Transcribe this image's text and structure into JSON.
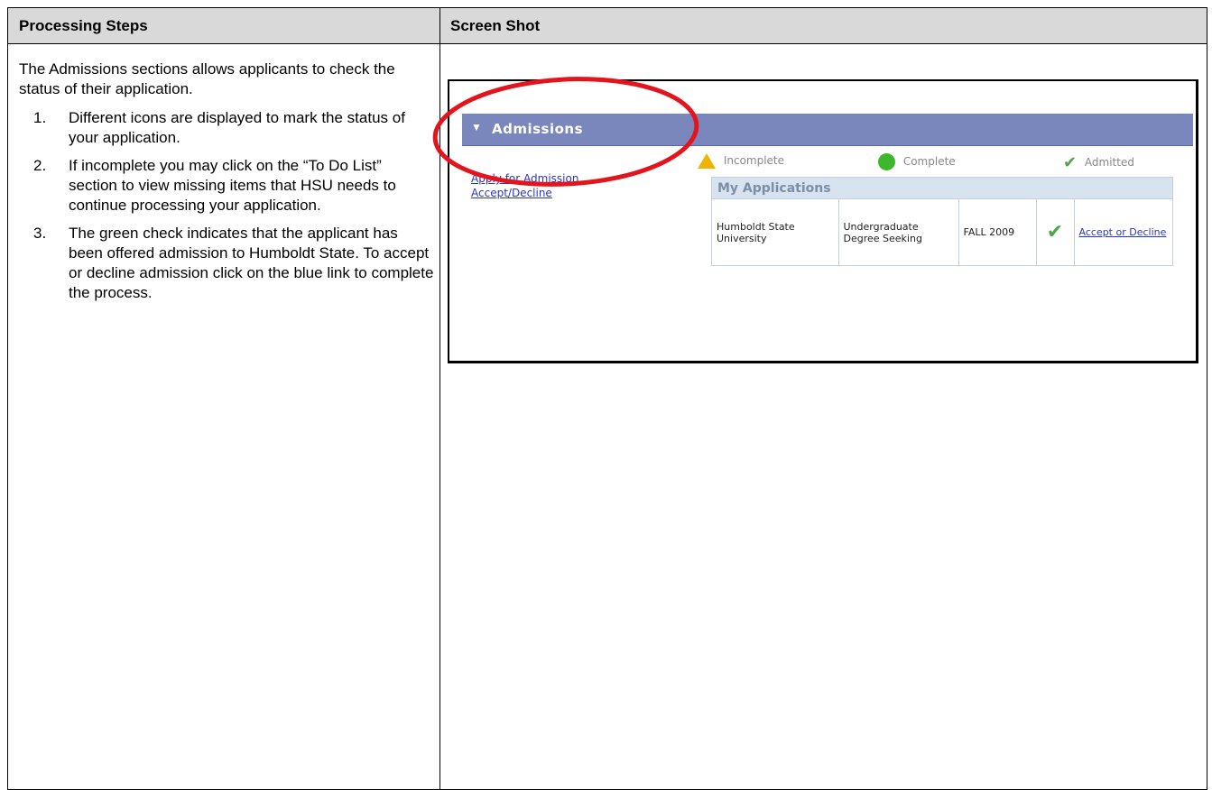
{
  "header": {
    "left": "Processing Steps",
    "right": "Screen Shot"
  },
  "steps": {
    "intro": "The Admissions sections allows applicants to check the status of their application.",
    "items": [
      {
        "num": "1.",
        "text": "Different icons are displayed to mark the status of your application."
      },
      {
        "num": "2.",
        "text": "If incomplete you may click on the “To Do List” section to view missing items that HSU needs to continue processing your application."
      },
      {
        "num": "3.",
        "text": "The green check indicates that the applicant has been offered admission to Humboldt State. To accept or decline admission click on the blue link to complete the process."
      }
    ]
  },
  "screenshot": {
    "section_title": "Admissions",
    "legend": {
      "incomplete": "Incomplete",
      "complete": "Complete",
      "admitted": "Admitted"
    },
    "links": {
      "apply": "Apply for Admission",
      "accept_decline": "Accept/Decline"
    },
    "applications": {
      "title": "My Applications",
      "row": {
        "institution": "Humboldt State University",
        "career": "Undergraduate Degree Seeking",
        "term": "FALL 2009",
        "action": "Accept or Decline"
      }
    }
  },
  "colors": {
    "header_bg": "#d9d9d9",
    "admissions_bar": "#7a87bd",
    "link": "#2a36c7",
    "highlight_ellipse": "#e3141c",
    "incomplete_icon": "#f0b400",
    "complete_icon": "#3db82c",
    "admitted_icon": "#4aa84a"
  },
  "icons": [
    "chevron-down-icon",
    "warning-triangle-icon",
    "green-circle-icon",
    "green-check-icon"
  ]
}
